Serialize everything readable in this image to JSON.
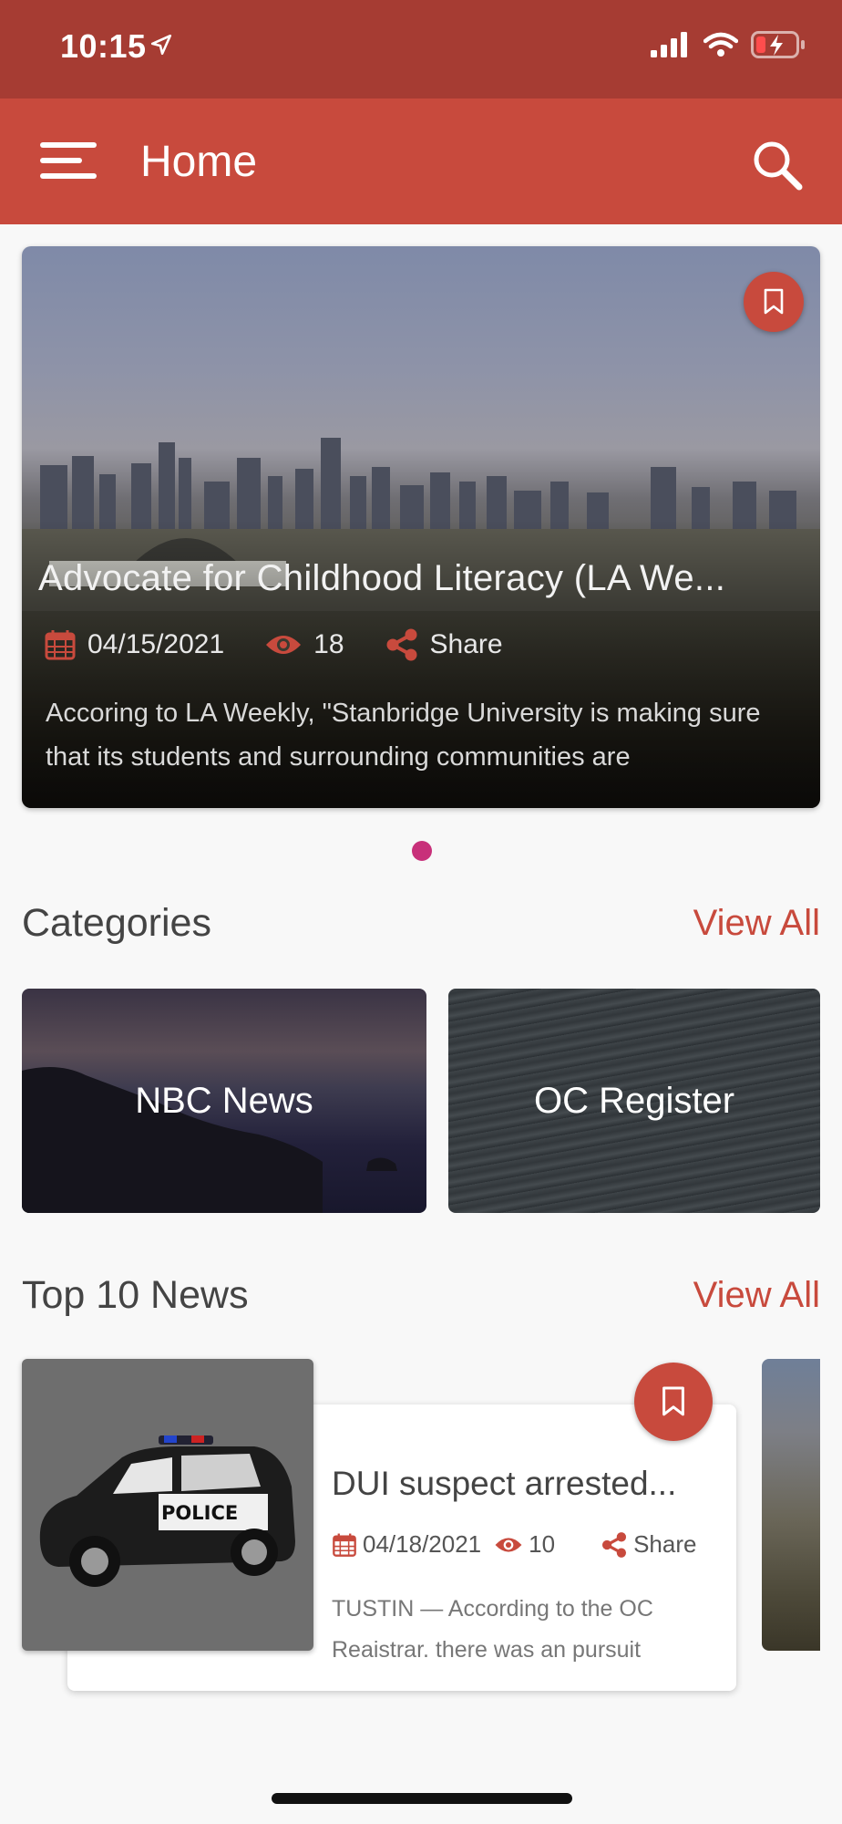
{
  "status_bar": {
    "time": "10:15"
  },
  "app_bar": {
    "title": "Home"
  },
  "featured": {
    "title": "Advocate for Childhood Literacy (LA We...",
    "date": "04/15/2021",
    "views": "18",
    "share_label": "Share",
    "excerpt": "Accoring to LA Weekly, \"Stanbridge University is making sure that its students and surrounding communities are"
  },
  "categories": {
    "title": "Categories",
    "view_all": "View All",
    "items": [
      {
        "label": "NBC News"
      },
      {
        "label": "OC Register"
      }
    ]
  },
  "top_news": {
    "title": "Top 10 News",
    "view_all": "View All",
    "items": [
      {
        "title": "DUI suspect arrested...",
        "date": "04/18/2021",
        "views": "10",
        "share_label": "Share",
        "excerpt": "TUSTIN — According to the OC Reaistrar. there was an pursuit",
        "thumb_label": "POLICE"
      }
    ]
  },
  "colors": {
    "status_bar": "#a63c33",
    "app_bar": "#c84a3d",
    "accent": "#c84a3d",
    "page_dot": "#c8307a"
  }
}
